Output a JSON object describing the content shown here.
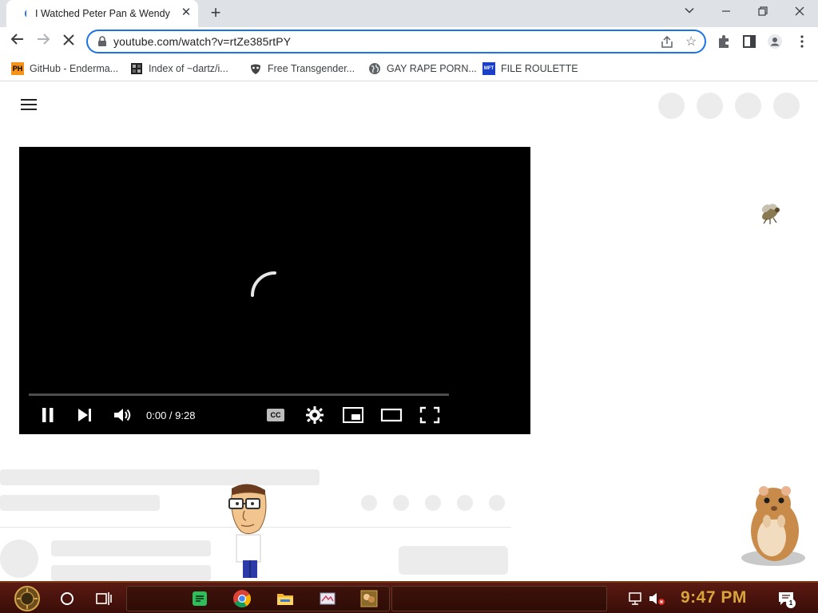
{
  "browser": {
    "tab_title": "I Watched Peter Pan & Wendy",
    "tab_close": "✕",
    "new_tab": "+",
    "window_controls": {
      "minimize": "—",
      "restore": "❐",
      "close": "✕",
      "tabsearch": "⌄"
    },
    "url": "youtube.com/watch?v=rtZe385rtPY",
    "bookmarks": [
      {
        "label": "GitHub - Enderma...",
        "icon": "ph-favicon"
      },
      {
        "label": "Index of ~dartz/i...",
        "icon": "index-favicon"
      },
      {
        "label": "Free Transgender...",
        "icon": "mask-favicon"
      },
      {
        "label": "GAY RAPE PORN...",
        "icon": "globe-favicon"
      },
      {
        "label": "FILE ROULETTE",
        "icon": "mft-favicon"
      }
    ],
    "ph_badge": "PH",
    "mft_badge": "MFT"
  },
  "player": {
    "time": "0:00 / 9:28",
    "progress_fraction": 0,
    "state": "loading",
    "cc_label": "CC"
  },
  "taskbar": {
    "clock": "9:47 PM",
    "icons": [
      "start-orb-icon",
      "cortana-circle-icon",
      "task-view-icon",
      "spotify-like-icon",
      "chrome-icon",
      "file-explorer-icon",
      "paint-icon",
      "game-icon"
    ],
    "notification_count": "1"
  },
  "colors": {
    "accent": "#1a73e8",
    "tabstrip": "#dee1e6",
    "player_bg": "#000000",
    "skeleton": "#ececec",
    "taskbar": "#4a140d",
    "clock": "#d9a53a"
  }
}
